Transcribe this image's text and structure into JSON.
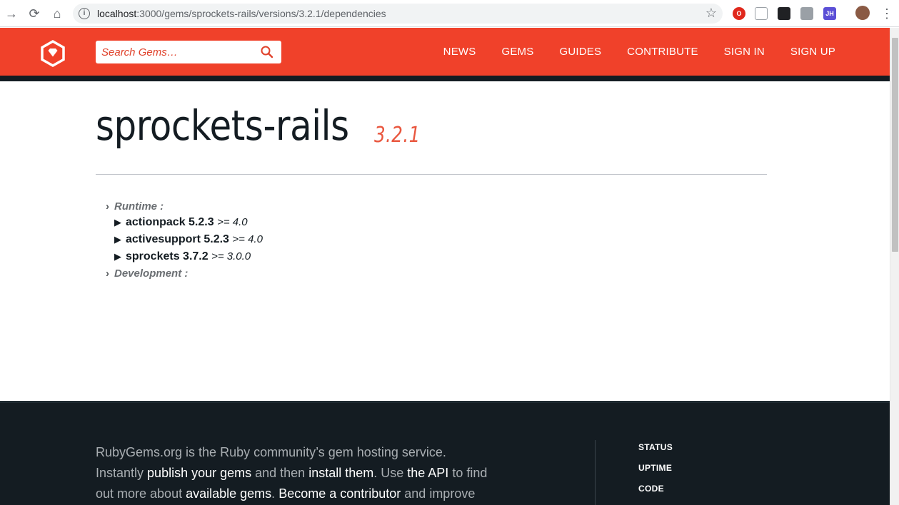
{
  "browser": {
    "url_host": "localhost",
    "url_rest": ":3000/gems/sprockets-rails/versions/3.2.1/dependencies",
    "extensions": [
      "opera-icon",
      "clipboard-icon",
      "mask-icon",
      "keyboard-icon"
    ],
    "jh_badge": "JH"
  },
  "header": {
    "search_placeholder": "Search Gems…",
    "nav": [
      "NEWS",
      "GEMS",
      "GUIDES",
      "CONTRIBUTE",
      "SIGN IN",
      "SIGN UP"
    ],
    "brand_color": "#f0412a"
  },
  "gem": {
    "name": "sprockets-rails",
    "version": "3.2.1"
  },
  "dependencies": {
    "runtime_label": "Runtime :",
    "runtime": [
      {
        "name": "actionpack 5.2.3",
        "requirement": ">= 4.0"
      },
      {
        "name": "activesupport 5.2.3",
        "requirement": ">= 4.0"
      },
      {
        "name": "sprockets 3.7.2",
        "requirement": ">= 3.0.0"
      }
    ],
    "development_label": "Development :"
  },
  "footer": {
    "line1": "RubyGems.org is the Ruby community’s gem hosting service.",
    "seg_instantly": "Instantly ",
    "link_publish": "publish your gems",
    "seg_and_then": " and then ",
    "link_install": "install them",
    "seg_use": ". Use ",
    "link_api": "the API",
    "seg_to_find": " to find",
    "seg_out_more": "out more about ",
    "link_available": "available gems",
    "seg_dot": ". ",
    "link_contributor": "Become a contributor",
    "seg_and_improve": " and improve",
    "links": [
      "STATUS",
      "UPTIME",
      "CODE"
    ]
  }
}
